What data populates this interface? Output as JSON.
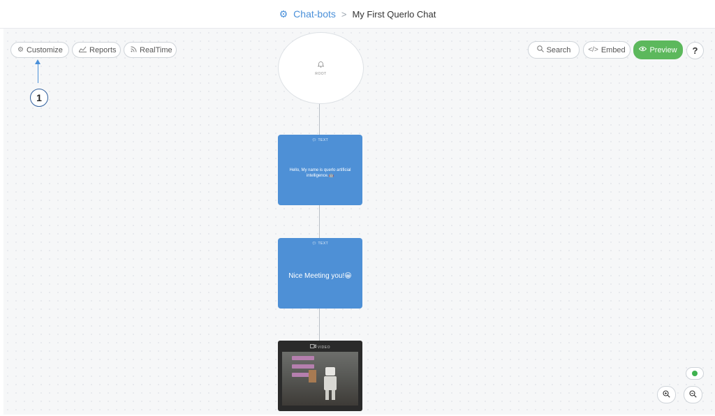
{
  "header": {
    "bot_icon": "robot-icon",
    "breadcrumb_root": "Chat-bots",
    "separator": ">",
    "current": "My First Querlo Chat"
  },
  "toolbar_left": {
    "customize": {
      "label": "Customize",
      "icon": "gear-icon"
    },
    "reports": {
      "label": "Reports",
      "icon": "chart-icon"
    },
    "realtime": {
      "label": "RealTime",
      "icon": "rss-icon"
    }
  },
  "toolbar_right": {
    "search": {
      "label": "Search",
      "icon": "search-icon"
    },
    "embed": {
      "label": "Embed",
      "icon": "code-icon"
    },
    "preview": {
      "label": "Preview",
      "icon": "eye-icon"
    },
    "help": {
      "label": "?"
    }
  },
  "annotation": {
    "number": "1"
  },
  "flow": {
    "root": {
      "type_label": "ROOT",
      "icon": "bell-icon"
    },
    "nodes": [
      {
        "type_label": "TEXT",
        "icon": "chat-bubble-icon",
        "text": "Hello, My name is querlo artificial intelligence.🤖"
      },
      {
        "type_label": "TEXT",
        "icon": "chat-bubble-icon",
        "text": "Nice Meeting you!😀"
      },
      {
        "type_label": "VIDEO",
        "icon": "video-camera-icon"
      }
    ]
  },
  "controls": {
    "status_color": "#3fb24f",
    "zoom_in": "zoom-in-icon",
    "zoom_out": "zoom-out-icon"
  },
  "colors": {
    "accent": "#4a90d9",
    "node_blue": "#4e90d6",
    "preview_green": "#5cb85c"
  }
}
